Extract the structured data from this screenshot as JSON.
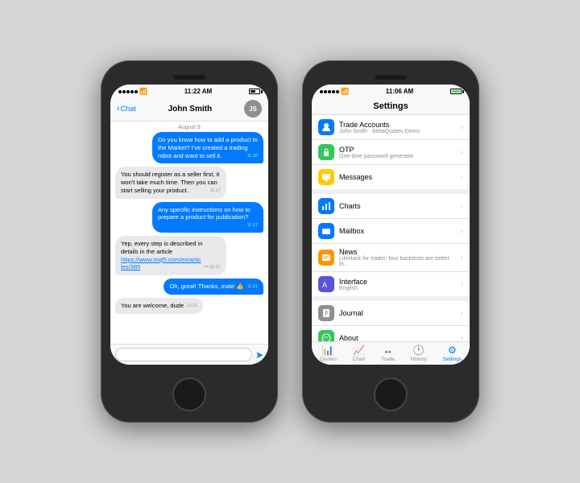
{
  "phone1": {
    "statusBar": {
      "signal": "•••••",
      "wifi": "wifi",
      "time": "11:22 AM",
      "battery": 60
    },
    "navBar": {
      "backLabel": "Chat",
      "title": "John Smith",
      "avatarInitials": "JS"
    },
    "chatDate": "August 9",
    "messages": [
      {
        "type": "out",
        "text": "Do you know how to add a product to the Market? I've created a trading robot and want to sell it.",
        "time": "11:16"
      },
      {
        "type": "in",
        "text": "You should register as a seller first, it won't take much time. Then you can start selling your product.",
        "time": "11:17"
      },
      {
        "type": "out",
        "text": "Any specific instructions on how to prepare a product for publication?",
        "time": "11:17"
      },
      {
        "type": "in",
        "text": "Yep, every step is described in details in the article https://www.mql5.com/en/articles/385",
        "link": "https://www.mql5.com/en/artic les/385",
        "time": "11:17",
        "extra": "••• 11:17"
      },
      {
        "type": "out",
        "text": "Oh, great! Thanks, mate 👍",
        "time": "11:21"
      },
      {
        "type": "in",
        "text": "You are welcome, dude",
        "time": "11:21"
      }
    ],
    "inputPlaceholder": ""
  },
  "phone2": {
    "statusBar": {
      "signal": "•••••",
      "wifi": "wifi",
      "time": "11:06 AM",
      "battery": 100,
      "batteryGreen": true
    },
    "navBar": {
      "title": "Settings"
    },
    "settingsGroups": [
      {
        "items": [
          {
            "icon": "🔵",
            "iconBg": "#007aff",
            "label": "Trade Accounts",
            "sub": "John Smith · MetaQuotes-Demo"
          },
          {
            "icon": "🔑",
            "iconBg": "#34c759",
            "label": "OTP",
            "sub": "One-time password generator"
          },
          {
            "icon": "💬",
            "iconBg": "#ffcc00",
            "label": "Messages",
            "sub": ""
          }
        ]
      },
      {
        "items": [
          {
            "icon": "📊",
            "iconBg": "#007aff",
            "label": "Charts",
            "sub": ""
          },
          {
            "icon": "✉️",
            "iconBg": "#007aff",
            "label": "Mailbox",
            "sub": ""
          },
          {
            "icon": "🟠",
            "iconBg": "#ff9500",
            "label": "News",
            "sub": "LifeHack for trader: four backtests are better th..."
          },
          {
            "icon": "🔤",
            "iconBg": "#5856d6",
            "label": "Interface",
            "sub": "English"
          }
        ]
      },
      {
        "items": [
          {
            "icon": "📋",
            "iconBg": "#8e8e93",
            "label": "Journal",
            "sub": ""
          },
          {
            "icon": "🌐",
            "iconBg": "#34c759",
            "label": "About",
            "sub": ""
          }
        ]
      }
    ],
    "tabBar": {
      "items": [
        {
          "icon": "💹",
          "label": "Quotes",
          "active": false
        },
        {
          "icon": "📈",
          "label": "Chart",
          "active": false
        },
        {
          "icon": "↔️",
          "label": "Trade",
          "active": false
        },
        {
          "icon": "🕐",
          "label": "History",
          "active": false
        },
        {
          "icon": "⚙️",
          "label": "Settings",
          "active": true
        }
      ]
    }
  }
}
